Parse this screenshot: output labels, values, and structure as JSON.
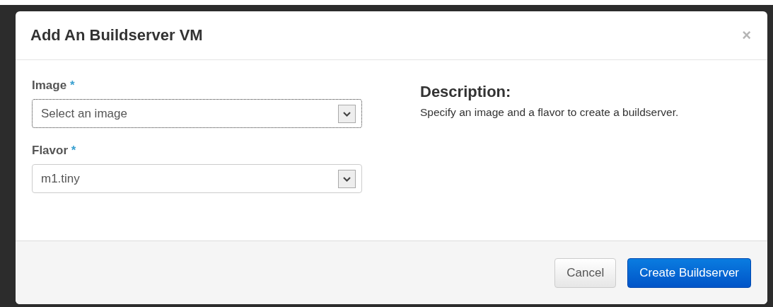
{
  "modal": {
    "title": "Add An Buildserver VM",
    "close": "×"
  },
  "fields": [
    {
      "label": "Image",
      "required": "*",
      "value": "Select an image",
      "focused": true
    },
    {
      "label": "Flavor",
      "required": "*",
      "value": "m1.tiny",
      "focused": false
    }
  ],
  "description": {
    "heading": "Description:",
    "text": "Specify an image and a flavor to create a buildserver."
  },
  "buttons": [
    {
      "label": "Cancel",
      "kind": "default"
    },
    {
      "label": "Create Buildserver",
      "kind": "primary"
    }
  ]
}
